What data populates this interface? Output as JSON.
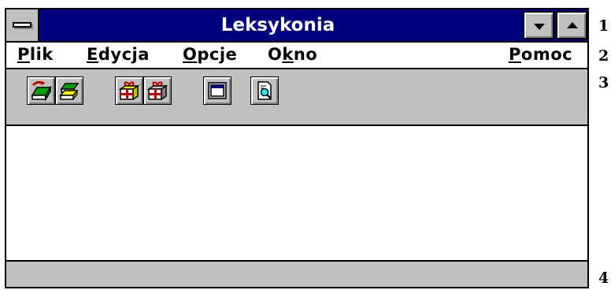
{
  "window": {
    "title": "Leksykonia"
  },
  "menubar": {
    "items": [
      {
        "mnemonic": "P",
        "rest": "lik"
      },
      {
        "mnemonic": "E",
        "rest": "dycja"
      },
      {
        "mnemonic": "O",
        "rest": "pcje"
      },
      {
        "pre": "O",
        "mnemonic": "k",
        "rest": "no"
      }
    ],
    "help": {
      "mnemonic": "P",
      "rest": "omoc"
    }
  },
  "toolbar": {
    "icons": [
      "open-book-icon",
      "book-stack-icon",
      "gift-box-icon",
      "gift-box-alt-icon",
      "window-icon",
      "preview-magnifier-icon"
    ]
  },
  "callouts": [
    "1",
    "2",
    "3",
    "4"
  ],
  "colors": {
    "titlebar": "#000080",
    "face": "#c0c0c0"
  }
}
